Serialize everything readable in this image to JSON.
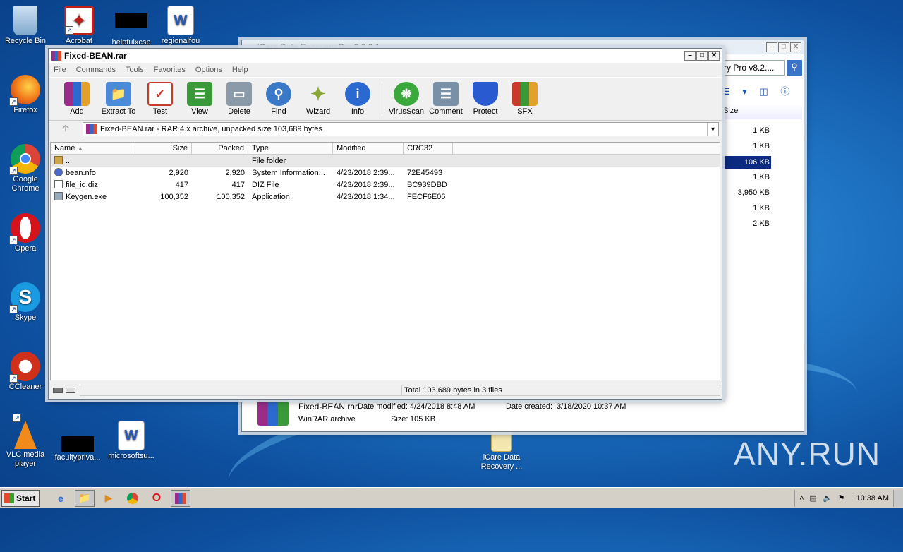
{
  "desktop": {
    "icons": [
      {
        "name": "recycle-bin-icon",
        "label": "Recycle Bin"
      },
      {
        "name": "acrobat-icon",
        "label": "Acrobat"
      },
      {
        "name": "helpfulxcsp-icon",
        "label": "helpfulxcsp"
      },
      {
        "name": "regionalfou-icon",
        "label": "regionalfou"
      },
      {
        "name": "firefox-icon",
        "label": "Firefox"
      },
      {
        "name": "chrome-icon",
        "label": "Google Chrome"
      },
      {
        "name": "opera-icon",
        "label": "Opera"
      },
      {
        "name": "skype-icon",
        "label": "Skype"
      },
      {
        "name": "ccleaner-icon",
        "label": "CCleaner"
      },
      {
        "name": "vlc-icon",
        "label": "VLC media player"
      },
      {
        "name": "facultypriva-icon",
        "label": "facultypriva..."
      },
      {
        "name": "microsoftsu-icon",
        "label": "microsoftsu..."
      },
      {
        "name": "icare-icon",
        "label": "iCare Data Recovery ..."
      }
    ],
    "watermark": "ANY.RUN"
  },
  "explorer": {
    "title": "iCare Data Recovery Pro 8.2.0.1",
    "address": "ry Pro v8.2....",
    "size_header": "Size",
    "sizes": [
      "1 KB",
      "1 KB",
      "106 KB",
      "1 KB",
      "3,950 KB",
      "1 KB",
      "2 KB"
    ],
    "selected_index": 2,
    "details": {
      "filename": "Fixed-BEAN.rar",
      "date_modified_label": "Date modified:",
      "date_modified": "4/24/2018 8:48 AM",
      "date_created_label": "Date created:",
      "date_created": "3/18/2020 10:37 AM",
      "type": "WinRAR archive",
      "size_label": "Size:",
      "size": "105 KB"
    }
  },
  "winrar": {
    "title": "Fixed-BEAN.rar",
    "menu": [
      "File",
      "Commands",
      "Tools",
      "Favorites",
      "Options",
      "Help"
    ],
    "toolbar": [
      {
        "label": "Add",
        "icon": "add-icon",
        "color": "#b0302a"
      },
      {
        "label": "Extract To",
        "icon": "extract-folder-icon",
        "color": "#4a8ad8"
      },
      {
        "label": "Test",
        "icon": "test-clipboard-icon",
        "color": "#c83a2a"
      },
      {
        "label": "View",
        "icon": "view-book-icon",
        "color": "#3a9a3a"
      },
      {
        "label": "Delete",
        "icon": "trash-icon",
        "color": "#8a9aa8"
      },
      {
        "label": "Find",
        "icon": "magnifier-icon",
        "color": "#3a78c8"
      },
      {
        "label": "Wizard",
        "icon": "wand-icon",
        "color": "#8aa838"
      },
      {
        "label": "Info",
        "icon": "info-icon",
        "color": "#2a6ad0"
      },
      {
        "label": "VirusScan",
        "icon": "virus-bug-icon",
        "color": "#3aa83a"
      },
      {
        "label": "Comment",
        "icon": "comment-icon",
        "color": "#7890a8"
      },
      {
        "label": "Protect",
        "icon": "shield-icon",
        "color": "#2a5ad0"
      },
      {
        "label": "SFX",
        "icon": "sfx-box-icon",
        "color": "#c85a28"
      }
    ],
    "address": "Fixed-BEAN.rar - RAR 4.x archive, unpacked size 103,689 bytes",
    "columns": [
      "Name",
      "Size",
      "Packed",
      "Type",
      "Modified",
      "CRC32"
    ],
    "rows": [
      {
        "name": "..",
        "size": "",
        "packed": "",
        "type": "File folder",
        "modified": "",
        "crc": "",
        "icon": "folder"
      },
      {
        "name": "bean.nfo",
        "size": "2,920",
        "packed": "2,920",
        "type": "System Information...",
        "modified": "4/23/2018 2:39...",
        "crc": "72E45493",
        "icon": "nfo"
      },
      {
        "name": "file_id.diz",
        "size": "417",
        "packed": "417",
        "type": "DIZ File",
        "modified": "4/23/2018 2:39...",
        "crc": "BC939DBD",
        "icon": "file"
      },
      {
        "name": "Keygen.exe",
        "size": "100,352",
        "packed": "100,352",
        "type": "Application",
        "modified": "4/23/2018 1:34...",
        "crc": "FECF6E06",
        "icon": "exe"
      }
    ],
    "status": "Total 103,689 bytes in 3 files"
  },
  "taskbar": {
    "start": "Start",
    "clock": "10:38 AM"
  }
}
